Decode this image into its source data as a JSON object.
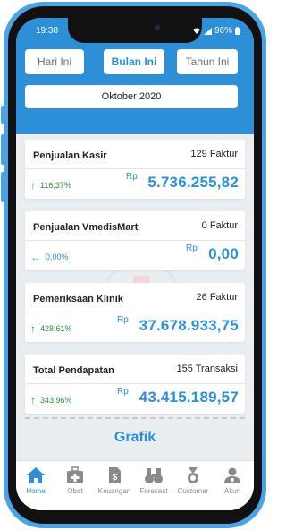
{
  "status": {
    "time": "19:38",
    "battery": "96%"
  },
  "tabs": [
    {
      "label": "Hari Ini",
      "active": false
    },
    {
      "label": "Bulan Ini",
      "active": true
    },
    {
      "label": "Tahun Ini",
      "active": false
    }
  ],
  "period": "Oktober 2020",
  "cards": [
    {
      "title": "Penjualan Kasir",
      "count": "129 Faktur",
      "trend": "up",
      "pct": "116,37%",
      "currency": "Rp",
      "amount": "5.736.255,82"
    },
    {
      "title": "Penjualan VmedisMart",
      "count": "0 Faktur",
      "trend": "flat",
      "pct": "0,00%",
      "currency": "Rp",
      "amount": "0,00"
    },
    {
      "title": "Pemeriksaan Klinik",
      "count": "26 Faktur",
      "trend": "up",
      "pct": "428,61%",
      "currency": "Rp",
      "amount": "37.678.933,75"
    },
    {
      "title": "Total Pendapatan",
      "count": "155 Transaksi",
      "trend": "up",
      "pct": "343,96%",
      "currency": "Rp",
      "amount": "43.415.189,57"
    }
  ],
  "grafik_label": "Grafik",
  "nav": [
    {
      "label": "Home",
      "icon": "home-icon",
      "active": true
    },
    {
      "label": "Obat",
      "icon": "medkit-icon",
      "active": false
    },
    {
      "label": "Keuangan",
      "icon": "money-icon",
      "active": false
    },
    {
      "label": "Forecast",
      "icon": "binoculars-icon",
      "active": false
    },
    {
      "label": "Customer",
      "icon": "customer-medal-icon",
      "active": false
    },
    {
      "label": "Akun",
      "icon": "account-icon",
      "active": false
    }
  ],
  "colors": {
    "primary": "#2d8fd8",
    "trend_up": "#2e8b3a",
    "trend_flat": "#2d8fd8",
    "background": "#ebeef1"
  }
}
